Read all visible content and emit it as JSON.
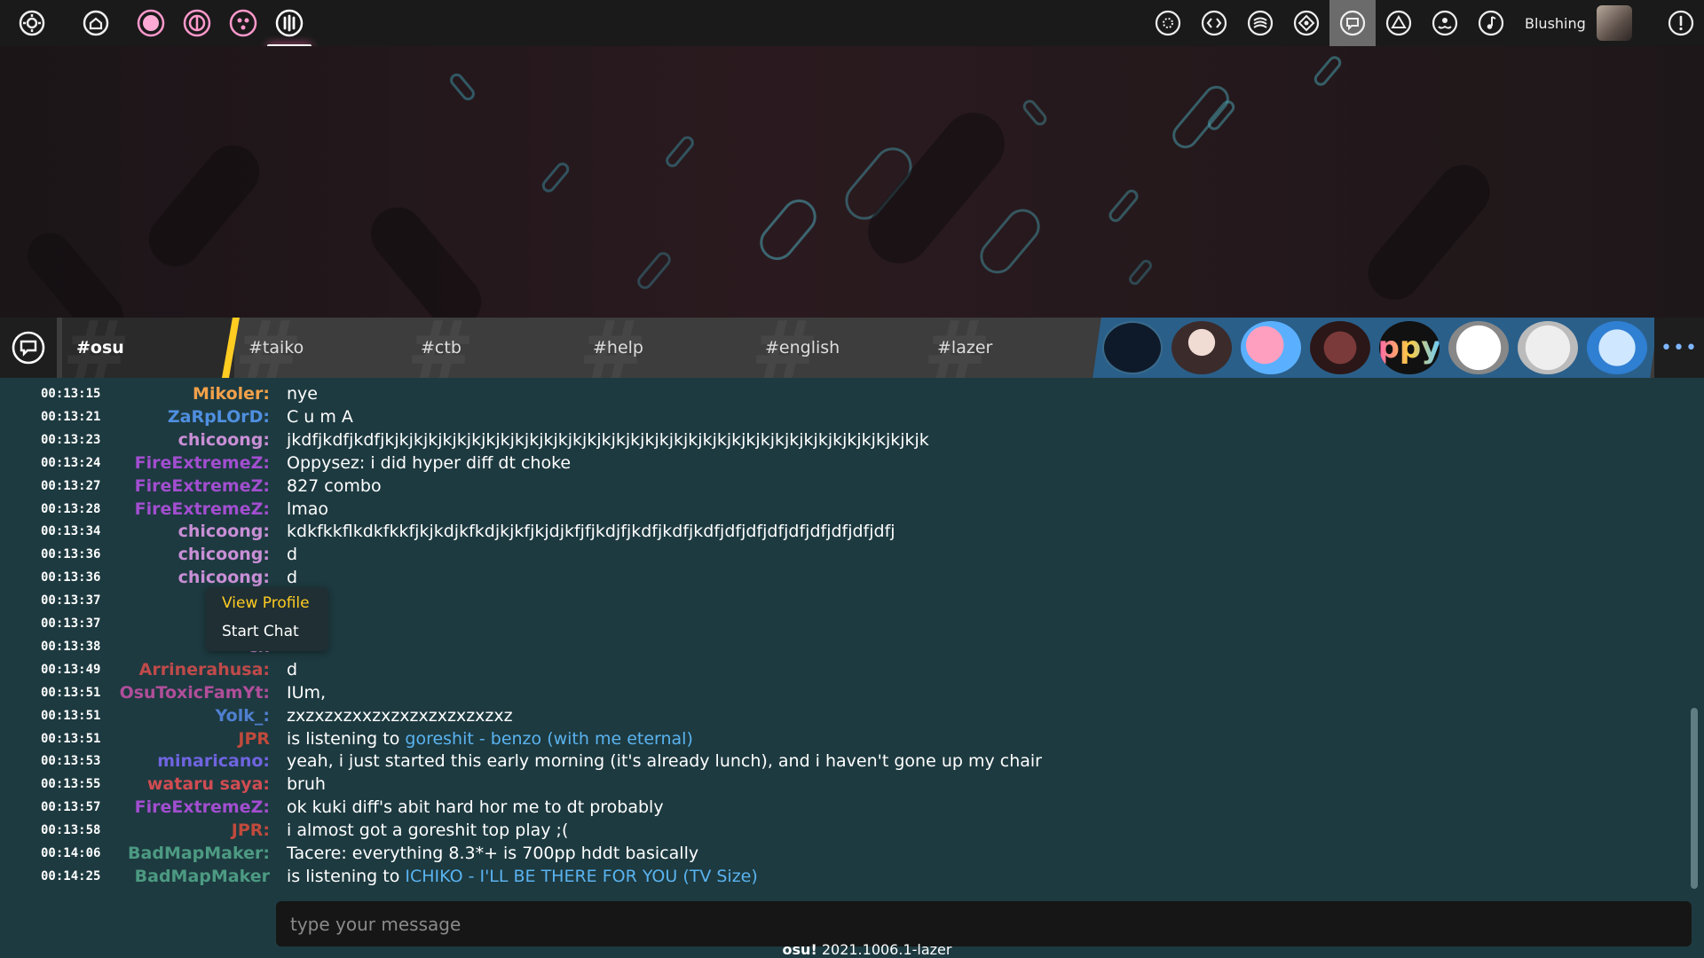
{
  "toolbar": {
    "left_icons": [
      "settings-icon",
      "home-icon",
      "ruleset-osu-icon",
      "ruleset-taiko-icon",
      "ruleset-catch-icon",
      "ruleset-mania-icon"
    ],
    "right_icons": [
      "news-icon",
      "changelog-icon",
      "rankings-icon",
      "beatmap-listing-icon",
      "chat-icon",
      "social-icon",
      "dashboard-icon",
      "music-icon"
    ],
    "user_name": "Blushing",
    "notifications_icon": "notification-icon"
  },
  "channels": {
    "tabs": [
      {
        "label": "#osu",
        "active": true
      },
      {
        "label": "#taiko",
        "active": false
      },
      {
        "label": "#ctb",
        "active": false
      },
      {
        "label": "#help",
        "active": false
      },
      {
        "label": "#english",
        "active": false
      },
      {
        "label": "#lazer",
        "active": false
      }
    ],
    "pm_avatars": [
      "avatar-1",
      "avatar-2",
      "avatar-slowpoke",
      "avatar-4",
      "ppy",
      "avatar-6",
      "avatar-7",
      "avatar-8"
    ],
    "pm_ppy_text": "ppy",
    "more_label": "•••"
  },
  "messages": [
    {
      "time": "00:13:15",
      "user": "Mikoler:",
      "color": "#f2a14a",
      "text": "nye"
    },
    {
      "time": "00:13:21",
      "user": "ZaRpLOrD:",
      "color": "#4f8fe0",
      "text": "C u m A"
    },
    {
      "time": "00:13:23",
      "user": "chicoong:",
      "color": "#c98fd6",
      "text": "jkdfjkdfjkdfjkjkjkjkjkjkjkjkjkjkjkjkjkjkjkjkjkjkjkjkjkjkjkjkjkjkjkjkjkjkjkjkjkjkjkjkjkjk"
    },
    {
      "time": "00:13:24",
      "user": "FireExtremeZ:",
      "color": "#a24ed0",
      "text": "Oppysez: i did hyper diff dt choke"
    },
    {
      "time": "00:13:27",
      "user": "FireExtremeZ:",
      "color": "#a24ed0",
      "text": "827 combo"
    },
    {
      "time": "00:13:28",
      "user": "FireExtremeZ:",
      "color": "#a24ed0",
      "text": "lmao"
    },
    {
      "time": "00:13:34",
      "user": "chicoong:",
      "color": "#c98fd6",
      "text": "kdkfkkflkdkfkkfjkjkdjkfkdjkjkfjkjdjkfjfjkdjfjkdfjkdfjkdfjdfjdfjdfjdfjdfjdfjdfjdfj"
    },
    {
      "time": "00:13:36",
      "user": "chicoong:",
      "color": "#c98fd6",
      "text": "d"
    },
    {
      "time": "00:13:36",
      "user": "chicoong:",
      "color": "#c98fd6",
      "text": "d"
    },
    {
      "time": "00:13:37",
      "user": "ch",
      "color": "#c98fd6",
      "text": ""
    },
    {
      "time": "00:13:37",
      "user": "ch",
      "color": "#c98fd6",
      "text": ""
    },
    {
      "time": "00:13:38",
      "user": "ch",
      "color": "#c98fd6",
      "text": ""
    },
    {
      "time": "00:13:49",
      "user": "Arrinerahusa:",
      "color": "#c04a4a",
      "text": "d"
    },
    {
      "time": "00:13:51",
      "user": "OsuToxicFamYt:",
      "color": "#b04e9a",
      "text": "IUm,"
    },
    {
      "time": "00:13:51",
      "user": "Yolk_:",
      "color": "#4f7fd0",
      "text": "zxzxzxzxxzxzxzxzxzxzxzxz"
    },
    {
      "time": "00:13:51",
      "user": "JPR",
      "color": "#c04a3c",
      "text": "is listening to ",
      "link": "goreshit - benzo (with me eternal)"
    },
    {
      "time": "00:13:53",
      "user": "minaricano:",
      "color": "#6f64e0",
      "text": "yeah, i just started this early morning (it's already lunch), and i haven't gone up my chair"
    },
    {
      "time": "00:13:55",
      "user": "wataru saya:",
      "color": "#d04c52",
      "text": "bruh"
    },
    {
      "time": "00:13:57",
      "user": "FireExtremeZ:",
      "color": "#a24ed0",
      "text": "ok kuki diff's abit hard hor me to dt probably"
    },
    {
      "time": "00:13:58",
      "user": "JPR:",
      "color": "#c04a3c",
      "text": "i almost got a goreshit top play ;("
    },
    {
      "time": "00:14:06",
      "user": "BadMapMaker:",
      "color": "#4c9a82",
      "text": "Tacere: everything 8.3*+ is 700pp hddt basically"
    },
    {
      "time": "00:14:25",
      "user": "BadMapMaker",
      "color": "#4c9a82",
      "text": "is listening to ",
      "link": "ICHIKO - I'LL BE THERE FOR YOU (TV Size)"
    }
  ],
  "context_menu": {
    "view_profile": "View Profile",
    "start_chat": "Start Chat"
  },
  "input": {
    "placeholder": "type your message",
    "value": ""
  },
  "footer": {
    "brand": "osu!",
    "version": "2021.1006.1-lazer"
  }
}
